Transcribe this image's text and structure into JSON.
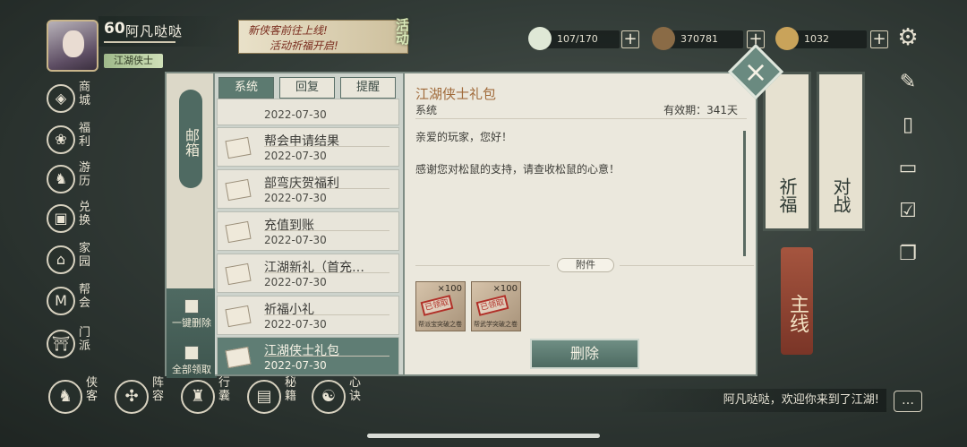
{
  "player": {
    "level": "60",
    "name": "阿凡哒哒",
    "title": "江湖侠士"
  },
  "event_banner": {
    "line1": "新侠客前往上线!",
    "line2": "活动祈福开启!",
    "tag": "活动"
  },
  "resources": [
    {
      "icon": "jade-icon",
      "value": "107/170"
    },
    {
      "icon": "silver-icon",
      "value": "370781"
    },
    {
      "icon": "gold-icon",
      "value": "1032"
    }
  ],
  "left_nav": [
    {
      "icon": "mall-icon",
      "label": "商城"
    },
    {
      "icon": "welfare-icon",
      "label": "福利"
    },
    {
      "icon": "travel-icon",
      "label": "游历"
    },
    {
      "icon": "exchange-icon",
      "label": "兑换"
    },
    {
      "icon": "home-icon",
      "label": "家园"
    },
    {
      "icon": "guild-icon",
      "label": "帮会"
    },
    {
      "icon": "sect-icon",
      "label": "门派"
    }
  ],
  "bottom_nav": [
    {
      "icon": "hero-icon",
      "label": "侠客"
    },
    {
      "icon": "formation-icon",
      "label": "阵容"
    },
    {
      "icon": "bag-icon",
      "label": "行囊"
    },
    {
      "icon": "manual-icon",
      "label": "秘籍"
    },
    {
      "icon": "skill-icon",
      "label": "心诀"
    }
  ],
  "chat": {
    "message": "阿凡哒哒，欢迎你来到了江湖!"
  },
  "banners": {
    "pray": "祈福",
    "battle": "对战",
    "main_quest": "主线"
  },
  "mail": {
    "tab_title": "邮箱",
    "tabs": [
      "系统",
      "回复",
      "提醒"
    ],
    "actions": {
      "delete_all": "一键删除",
      "claim_all": "全部领取"
    },
    "items": [
      {
        "title": "",
        "date": "2022-07-30"
      },
      {
        "title": "帮会申请结果",
        "date": "2022-07-30"
      },
      {
        "title": "部弯庆贺福利",
        "date": "2022-07-30"
      },
      {
        "title": "充值到账",
        "date": "2022-07-30"
      },
      {
        "title": "江湖新礼（首充…",
        "date": "2022-07-30"
      },
      {
        "title": "祈福小礼",
        "date": "2022-07-30"
      },
      {
        "title": "江湖侠士礼包",
        "date": "2022-07-30"
      }
    ],
    "detail": {
      "title": "江湖侠士礼包",
      "sender": "系统",
      "validity": "有效期：341天",
      "greeting": "亲爱的玩家，您好！",
      "body": "感谢您对松鼠的支持，请查收松鼠的心意！",
      "attachment_label": "附件",
      "attachments": [
        {
          "qty": "×100",
          "stamp": "已领取",
          "name": "帮派宝突破之卷"
        },
        {
          "qty": "×100",
          "stamp": "已领取",
          "name": "帮武学突破之卷"
        }
      ],
      "delete_label": "删除"
    }
  }
}
